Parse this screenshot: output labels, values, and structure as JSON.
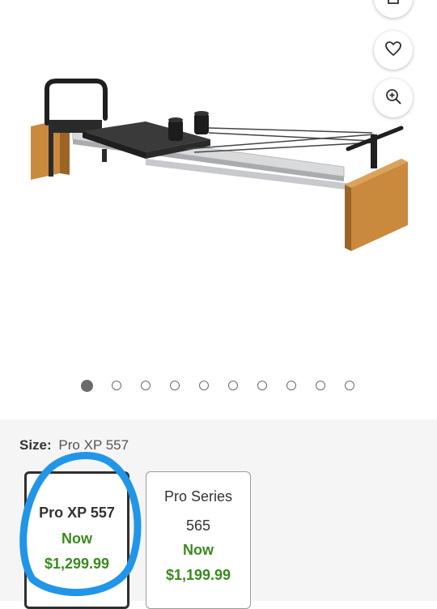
{
  "gallery": {
    "image_alt": "Pilates reformer",
    "dot_count": 10,
    "active_dot": 0
  },
  "size": {
    "label": "Size:",
    "selected_value": "Pro XP 557"
  },
  "options": [
    {
      "name": "Pro XP 557",
      "now_label": "Now",
      "price": "$1,299.99",
      "selected": true
    },
    {
      "name": "Pro Series 565",
      "now_label": "Now",
      "price": "$1,199.99",
      "selected": false
    }
  ],
  "colors": {
    "price_green": "#3a8a1e",
    "annotation_blue": "#2196e8",
    "panel_bg": "#f5f5f5"
  }
}
